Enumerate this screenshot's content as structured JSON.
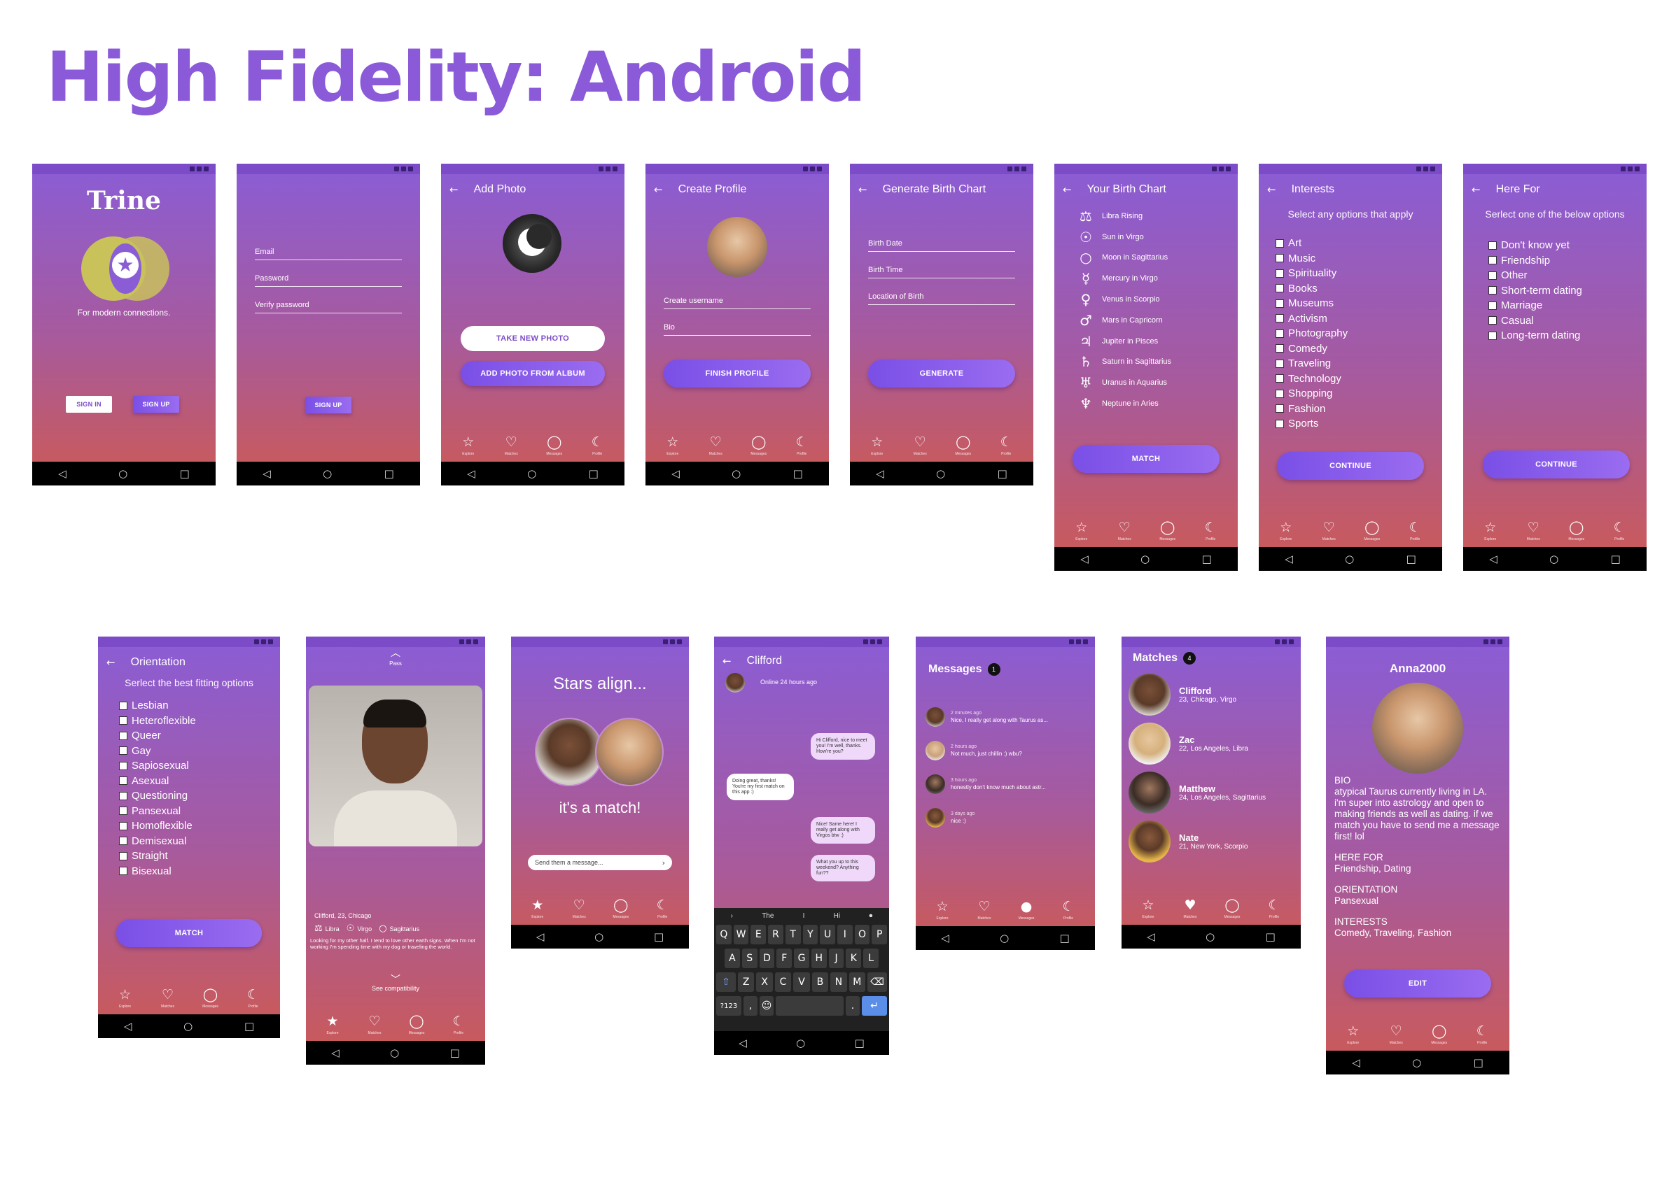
{
  "page": {
    "title": "High Fidelity: Android"
  },
  "colors": {
    "accent": "#8a5ad9",
    "gradient_top": "#8a5dd6",
    "gradient_bottom": "#cc5a55",
    "button": "#7a4fe6"
  },
  "icons": {
    "back": "arrow-left-icon",
    "explore": "star-icon",
    "matches": "heart-icon",
    "messages": "chat-bubble-icon",
    "profile": "moon-icon"
  },
  "nav": {
    "back": "◁",
    "home": "○",
    "recents": "□"
  },
  "tabs": {
    "explore": "Explore",
    "matches": "Matches",
    "messages": "Messages",
    "profile": "Profile"
  },
  "splash": {
    "logo": "Trine",
    "tagline": "For modern connections.",
    "signin": "SIGN IN",
    "signup": "SIGN UP"
  },
  "signup": {
    "email": "Email",
    "password": "Password",
    "verify": "Verify password",
    "button": "SIGN UP"
  },
  "addphoto": {
    "title": "Add Photo",
    "take": "TAKE NEW PHOTO",
    "album": "ADD PHOTO FROM ALBUM"
  },
  "createprofile": {
    "title": "Create Profile",
    "username": "Create username",
    "bio": "Bio",
    "button": "FINISH PROFILE"
  },
  "birthchart": {
    "title": "Generate Birth Chart",
    "date": "Birth Date",
    "time": "Birth Time",
    "location": "Location of Birth",
    "button": "GENERATE"
  },
  "yourchart": {
    "title": "Your Birth Chart",
    "items": [
      {
        "sym": "⚖",
        "label": "Libra Rising"
      },
      {
        "sym": "☉",
        "label": "Sun in Virgo"
      },
      {
        "sym": "○",
        "label": "Moon in Sagittarius"
      },
      {
        "sym": "☿",
        "label": "Mercury in Virgo"
      },
      {
        "sym": "♀",
        "label": "Venus in Scorpio"
      },
      {
        "sym": "♂",
        "label": "Mars in Capricorn"
      },
      {
        "sym": "♃",
        "label": "Jupiter in Pisces"
      },
      {
        "sym": "♄",
        "label": "Saturn in Sagittarius"
      },
      {
        "sym": "♅",
        "label": "Uranus in Aquarius"
      },
      {
        "sym": "♆",
        "label": "Neptune in Aries"
      }
    ],
    "button": "MATCH"
  },
  "interests": {
    "title": "Interests",
    "subtitle": "Select any options that apply",
    "options": [
      "Art",
      "Music",
      "Spirituality",
      "Books",
      "Museums",
      "Activism",
      "Photography",
      "Comedy",
      "Traveling",
      "Technology",
      "Shopping",
      "Fashion",
      "Sports"
    ],
    "button": "CONTINUE"
  },
  "herefor": {
    "title": "Here For",
    "subtitle": "Serlect one of the below options",
    "options": [
      "Don't know yet",
      "Friendship",
      "Other",
      "Short-term dating",
      "Marriage",
      "Casual",
      "Long-term dating"
    ],
    "button": "CONTINUE"
  },
  "orientation": {
    "title": "Orientation",
    "subtitle": "Serlect the best fitting options",
    "options": [
      "Lesbian",
      "Heteroflexible",
      "Queer",
      "Gay",
      "Sapiosexual",
      "Asexual",
      "Questioning",
      "Pansexual",
      "Homoflexible",
      "Demisexual",
      "Straight",
      "Bisexual"
    ],
    "button": "MATCH"
  },
  "card": {
    "pass": "Pass",
    "info": "Clifford, 23, Chicago",
    "sign1": "Libra",
    "sign2": "Virgo",
    "sign3": "Sagittarius",
    "bio": "Looking for my other half. I tend to love other earth signs. When I'm not working I'm spending time with my dog or traveling the world.",
    "compat": "See compatibility"
  },
  "match": {
    "title": "Stars align...",
    "text": "it's a match!",
    "placeholder": "Send them a message..."
  },
  "chat": {
    "name": "Clifford",
    "status": "Online 24 hours ago",
    "bubbles": [
      "Hi Clifford, nice to meet you! I'm well, thanks. How're you?",
      "Doing great, thanks! You're my first match on this app :)",
      "Nice! Same here! I really get along with Virgos btw :)",
      "What you up to this weekend? Anything fun??"
    ],
    "suggestions": [
      "The",
      "I",
      "Hi"
    ],
    "row1": [
      "Q",
      "W",
      "E",
      "R",
      "T",
      "Y",
      "U",
      "I",
      "O",
      "P"
    ],
    "row2": [
      "A",
      "S",
      "D",
      "F",
      "G",
      "H",
      "J",
      "K",
      "L"
    ],
    "row3": [
      "Z",
      "X",
      "C",
      "V",
      "B",
      "N",
      "M"
    ],
    "num": "?123",
    "comma": ",",
    "period": "."
  },
  "messages": {
    "title": "Messages",
    "count": "1",
    "items": [
      {
        "time": "2 minutes ago",
        "text": "Nice, I really get along with Taurus as..."
      },
      {
        "time": "2 hours ago",
        "text": "Not much, just chillin :) wbu?"
      },
      {
        "time": "3 hours ago",
        "text": "honestly don't know much about astr..."
      },
      {
        "time": "3 days ago",
        "text": "nice :)"
      }
    ]
  },
  "matches": {
    "title": "Matches",
    "count": "4",
    "items": [
      {
        "name": "Clifford",
        "info": "23, Chicago, Virgo"
      },
      {
        "name": "Zac",
        "info": "22, Los Angeles, Libra"
      },
      {
        "name": "Matthew",
        "info": "24, Los Angeles, Sagittarius"
      },
      {
        "name": "Nate",
        "info": "21, New York, Scorpio"
      }
    ]
  },
  "profile": {
    "name": "Anna2000",
    "bio_h": "BIO",
    "bio": "atypical Taurus currently living in LA. i'm super into astrology and open to making friends as well as dating. if we match you have to send me a message first! lol",
    "here_h": "HERE FOR",
    "here": "Friendship, Dating",
    "orient_h": "ORIENTATION",
    "orient": "Pansexual",
    "int_h": "INTERESTS",
    "int": "Comedy, Traveling, Fashion",
    "button": "EDIT"
  }
}
